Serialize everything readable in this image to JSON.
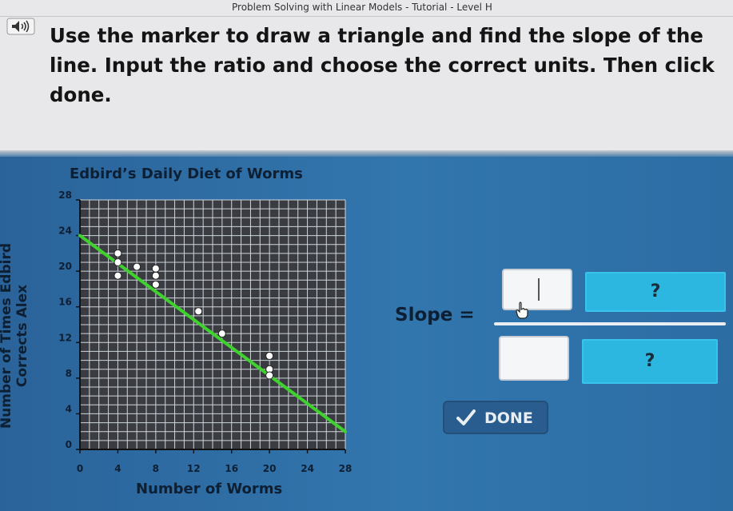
{
  "window": {
    "title": "Problem Solving with Linear Models - Tutorial - Level H"
  },
  "instructions": "Use the marker to draw a triangle and find the slope of the line. Input the ratio and choose the correct units. Then click done.",
  "icons": {
    "speaker": "speaker-icon",
    "check": "check-icon",
    "cursor": "hand-pointer-icon"
  },
  "colors": {
    "header_bg": "#e8e8ea",
    "main_bg": "#2f6fa6",
    "line": "#3fd12e",
    "grid": "#2d2f34",
    "unit_box": "#2bb7e0"
  },
  "chart_data": {
    "type": "scatter",
    "title": "Edbird’s Daily Diet of Worms",
    "xlabel": "Number of Worms",
    "ylabel": "Number of Times Edbird Corrects Alex",
    "x_ticks": [
      "0",
      "4",
      "8",
      "12",
      "16",
      "20",
      "24",
      "28"
    ],
    "y_ticks": [
      "0",
      "4",
      "8",
      "12",
      "16",
      "20",
      "24",
      "28"
    ],
    "xlim": [
      0,
      28
    ],
    "ylim": [
      0,
      28
    ],
    "grid": true,
    "points": [
      {
        "x": 4,
        "y": 22
      },
      {
        "x": 4,
        "y": 21
      },
      {
        "x": 4,
        "y": 19.5
      },
      {
        "x": 6,
        "y": 20.5
      },
      {
        "x": 8,
        "y": 20.3
      },
      {
        "x": 8,
        "y": 19.5
      },
      {
        "x": 8,
        "y": 18.5
      },
      {
        "x": 12.5,
        "y": 15.5
      },
      {
        "x": 15,
        "y": 13
      },
      {
        "x": 20,
        "y": 10.5
      },
      {
        "x": 20,
        "y": 9
      },
      {
        "x": 20,
        "y": 8.3
      }
    ],
    "trend_line": {
      "x": [
        0,
        28
      ],
      "y": [
        24,
        2
      ]
    }
  },
  "slope": {
    "label": "Slope =",
    "numerator_value": "",
    "denominator_value": "",
    "numerator_unit": "?",
    "denominator_unit": "?"
  },
  "done_button": {
    "label": "DONE"
  }
}
